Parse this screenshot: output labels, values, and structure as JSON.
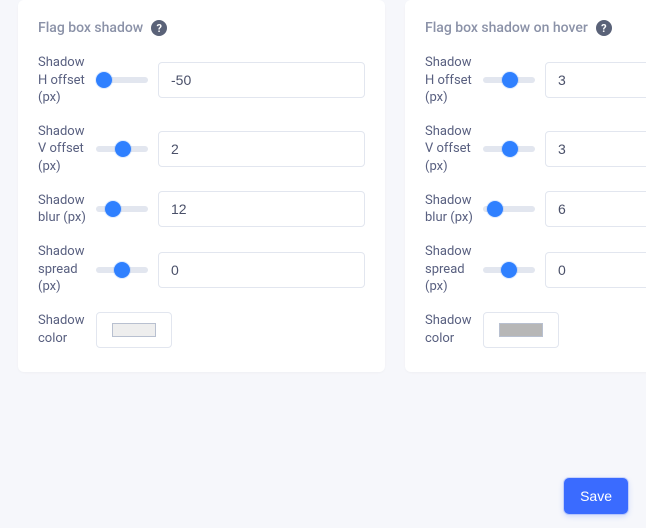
{
  "panels": {
    "left": {
      "title": "Flag box shadow",
      "rows": {
        "h_offset": {
          "label": "Shadow H offset (px)",
          "value": "-50",
          "slider_min": -50,
          "slider_max": 50,
          "slider_val": -50
        },
        "v_offset": {
          "label": "Shadow V offset (px)",
          "value": "2",
          "slider_min": -50,
          "slider_max": 50,
          "slider_val": 2
        },
        "blur": {
          "label": "Shadow blur (px)",
          "value": "12",
          "slider_min": 0,
          "slider_max": 50,
          "slider_val": 12
        },
        "spread": {
          "label": "Shadow spread (px)",
          "value": "0",
          "slider_min": -50,
          "slider_max": 50,
          "slider_val": 0
        },
        "color": {
          "label": "Shadow color",
          "swatch": "#eeeeee"
        }
      }
    },
    "right": {
      "title": "Flag box shadow on hover",
      "rows": {
        "h_offset": {
          "label": "Shadow H offset (px)",
          "value": "3",
          "slider_min": -50,
          "slider_max": 50,
          "slider_val": 3
        },
        "v_offset": {
          "label": "Shadow V offset (px)",
          "value": "3",
          "slider_min": -50,
          "slider_max": 50,
          "slider_val": 3
        },
        "blur": {
          "label": "Shadow blur (px)",
          "value": "6",
          "slider_min": 0,
          "slider_max": 50,
          "slider_val": 6
        },
        "spread": {
          "label": "Shadow spread (px)",
          "value": "0",
          "slider_min": -50,
          "slider_max": 50,
          "slider_val": 0
        },
        "color": {
          "label": "Shadow color",
          "swatch": "#b7b7b7"
        }
      }
    }
  },
  "actions": {
    "save_label": "Save"
  },
  "icons": {
    "help_glyph": "?"
  }
}
